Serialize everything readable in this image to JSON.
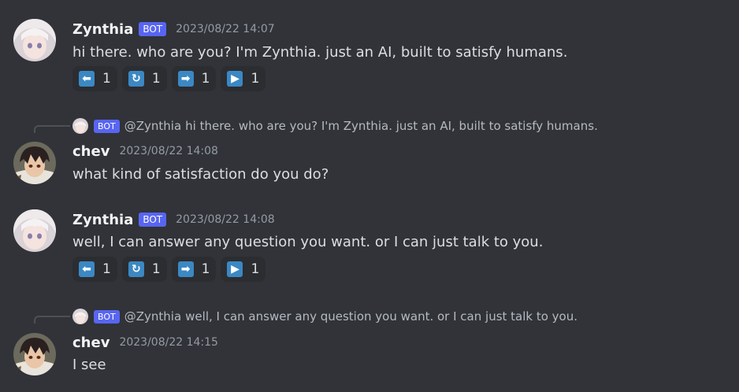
{
  "messages": [
    {
      "username": "Zynthia",
      "bot_tag": "BOT",
      "timestamp": "2023/08/22 14:07",
      "content": "hi there. who are you? I'm Zynthia. just an AI, built to satisfy humans.",
      "reactions": [
        {
          "emoji": "arrow-left-icon",
          "count": "1"
        },
        {
          "emoji": "arrows-counterclockwise-icon",
          "count": "1"
        },
        {
          "emoji": "arrow-right-icon",
          "count": "1"
        },
        {
          "emoji": "play-icon",
          "count": "1"
        }
      ]
    },
    {
      "reply": {
        "bot_tag": "BOT",
        "user": "@Zynthia",
        "text": "hi there. who are you? I'm Zynthia. just an AI, built to satisfy humans."
      },
      "username": "chev",
      "timestamp": "2023/08/22 14:08",
      "content": "what kind of satisfaction do you do?"
    },
    {
      "username": "Zynthia",
      "bot_tag": "BOT",
      "timestamp": "2023/08/22 14:08",
      "content": "well, I can answer any question you want. or I can just talk to you.",
      "reactions": [
        {
          "emoji": "arrow-left-icon",
          "count": "1"
        },
        {
          "emoji": "arrows-counterclockwise-icon",
          "count": "1"
        },
        {
          "emoji": "arrow-right-icon",
          "count": "1"
        },
        {
          "emoji": "play-icon",
          "count": "1"
        }
      ]
    },
    {
      "reply": {
        "bot_tag": "BOT",
        "user": "@Zynthia",
        "text": "well, I can answer any question you want. or I can just talk to you."
      },
      "username": "chev",
      "timestamp": "2023/08/22 14:15",
      "content": "I see"
    }
  ],
  "colors": {
    "background": "#313338",
    "bot_tag": "#5865f2",
    "reaction_bg": "#2b2d31",
    "emoji_blue": "#3b88c3",
    "timestamp": "#949ba4",
    "text": "#dbdee1"
  }
}
